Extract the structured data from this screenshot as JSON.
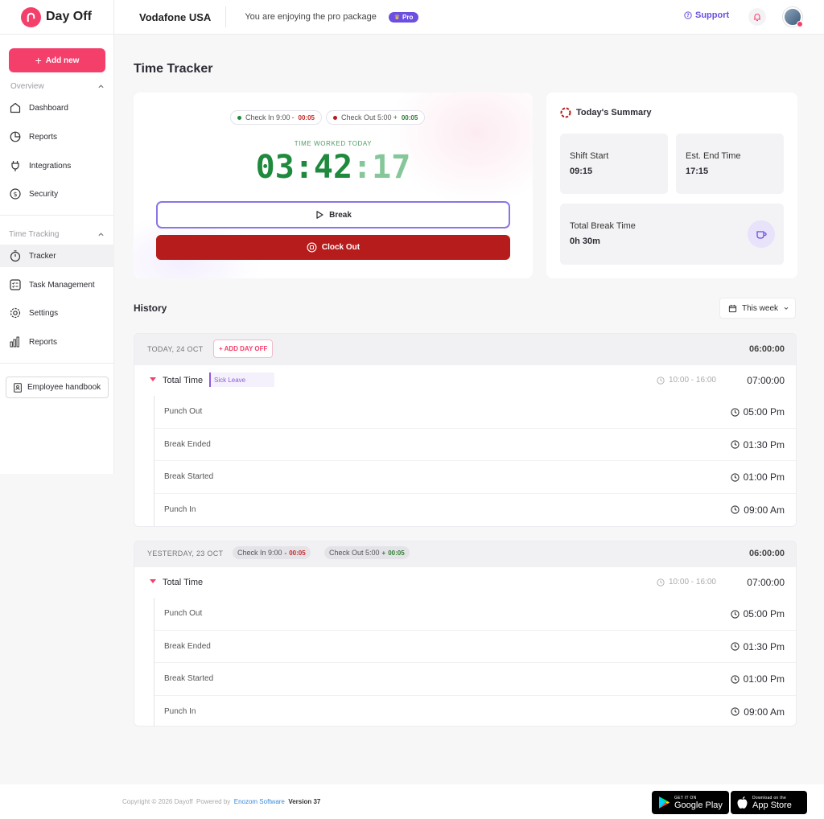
{
  "brand": {
    "name": "Day Off"
  },
  "header": {
    "company": "Vodafone USA",
    "pro_message": "You are enjoying the pro package",
    "pro_badge": "Pro",
    "support": "Support"
  },
  "sidebar": {
    "add_new": "Add new",
    "overview_label": "Overview",
    "overview_items": [
      "Dashboard",
      "Reports",
      "Integrations",
      "Security"
    ],
    "time_tracking_label": "Time Tracking",
    "time_items": [
      "Tracker",
      "Task Management",
      "Settings",
      "Reports"
    ],
    "handbook": "Employee handbook"
  },
  "page": {
    "title": "Time Tracker"
  },
  "tracker": {
    "check_in": "Check In 9:00",
    "check_in_delta": "00:05",
    "check_out": "Check Out 5:00",
    "check_out_delta": "00:05",
    "worked_label": "TIME WORKED TODAY",
    "hm": "03:42",
    "colon": ":",
    "sec": "17",
    "break_label": "Break",
    "clock_out_label": "Clock Out"
  },
  "summary": {
    "title": "Today's Summary",
    "shift_start_label": "Shift Start",
    "shift_start_value": "09:15",
    "est_end_label": "Est. End Time",
    "est_end_value": "17:15",
    "break_label": "Total Break Time",
    "break_value": "0h 30m"
  },
  "history": {
    "title": "History",
    "filter": "This week",
    "days": [
      {
        "date": "TODAY, 24 OCT",
        "add_day_off": "+ ADD DAY OFF",
        "total": "06:00:00",
        "total_label": "Total Time",
        "leave_tag": "Sick Leave",
        "range": "10:00 - 16:00",
        "range_total": "07:00:00",
        "events": [
          {
            "label": "Punch Out",
            "time": "05:00 Pm"
          },
          {
            "label": "Break Ended",
            "time": "01:30 Pm"
          },
          {
            "label": "Break Started",
            "time": "01:00 Pm"
          },
          {
            "label": "Punch In",
            "time": "09:00 Am"
          }
        ]
      },
      {
        "date": "YESTERDAY, 23 OCT",
        "check_in": "Check In 9:00",
        "check_in_delta": "00:05",
        "check_out": "Check Out 5:00",
        "check_out_delta": "00:05",
        "total": "06:00:00",
        "total_label": "Total Time",
        "range": "10:00 - 16:00",
        "range_total": "07:00:00",
        "events": [
          {
            "label": "Punch Out",
            "time": "05:00 Pm"
          },
          {
            "label": "Break Ended",
            "time": "01:30 Pm"
          },
          {
            "label": "Break Started",
            "time": "01:00 Pm"
          },
          {
            "label": "Punch In",
            "time": "09:00 Am"
          }
        ]
      }
    ]
  },
  "footer": {
    "copyright": "Copyright © 2026 Dayoff",
    "powered_by": "Powered by",
    "company": "Enozom Software",
    "version_label": "Version",
    "version": "37",
    "google_small": "GET IT ON",
    "google_big": "Google Play",
    "apple_small": "Download on the",
    "apple_big": "App Store"
  },
  "colors": {
    "accent": "#f43f6b",
    "purple": "#6c4ee0",
    "danger": "#b71c1c",
    "success": "#1f8a3d"
  }
}
